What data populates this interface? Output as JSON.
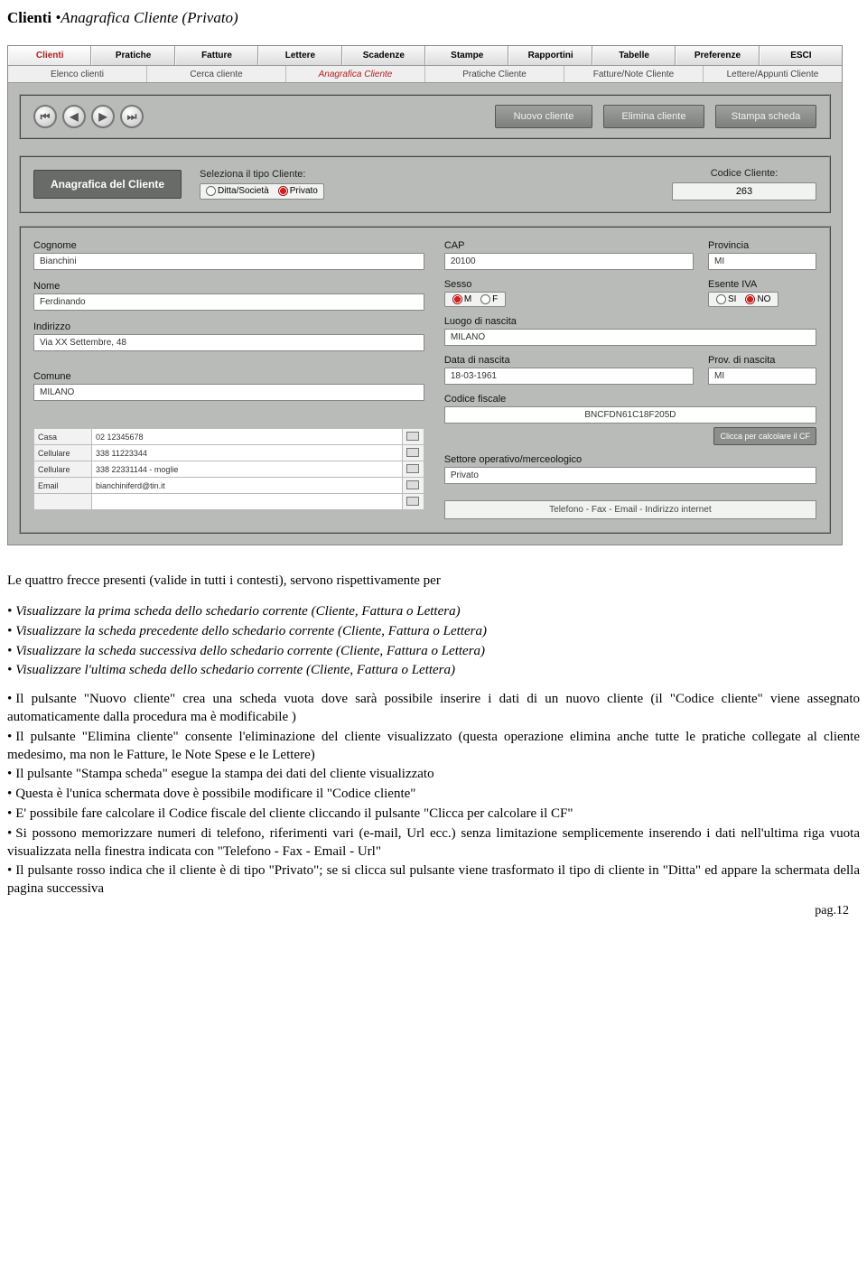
{
  "doc": {
    "title_bold": "Clienti ",
    "title_italic": "•Anagrafica Cliente (Privato)",
    "page_num": "pag.12"
  },
  "app": {
    "main_tabs": [
      "Clienti",
      "Pratiche",
      "Fatture",
      "Lettere",
      "Scadenze",
      "Stampe",
      "Rapportini",
      "Tabelle",
      "Preferenze",
      "ESCI"
    ],
    "main_tab_active_index": 0,
    "sub_tabs": [
      "Elenco clienti",
      "Cerca cliente",
      "Anagrafica Cliente",
      "Pratiche Cliente",
      "Fatture/Note Cliente",
      "Lettere/Appunti Cliente"
    ],
    "sub_tab_active_index": 2,
    "toolbar": {
      "nuovo": "Nuovo cliente",
      "elimina": "Elimina cliente",
      "stampa": "Stampa scheda"
    },
    "type_panel": {
      "title": "Anagrafica del Cliente",
      "select_label": "Seleziona il tipo Cliente:",
      "opt_ditta": "Ditta/Società",
      "opt_privato": "Privato",
      "selected": "Privato",
      "codice_label": "Codice Cliente:",
      "codice_value": "263"
    },
    "form": {
      "cognome_label": "Cognome",
      "cognome": "Bianchini",
      "nome_label": "Nome",
      "nome": "Ferdinando",
      "indirizzo_label": "Indirizzo",
      "indirizzo": "Via XX Settembre, 48",
      "comune_label": "Comune",
      "comune": "MILANO",
      "cap_label": "CAP",
      "cap": "20100",
      "provincia_label": "Provincia",
      "provincia": "MI",
      "sesso_label": "Sesso",
      "sesso_m": "M",
      "sesso_f": "F",
      "sesso_sel": "M",
      "esente_label": "Esente IVA",
      "esente_si": "SI",
      "esente_no": "NO",
      "esente_sel": "NO",
      "luogo_label": "Luogo di nascita",
      "luogo": "MILANO",
      "data_label": "Data di nascita",
      "data": "18-03-1961",
      "provn_label": "Prov. di nascita",
      "provn": "MI",
      "cf_label": "Codice fiscale",
      "cf": "BNCFDN61C18F205D",
      "cf_btn": "Clicca per calcolare il CF",
      "settore_label": "Settore operativo/merceologico",
      "settore": "Privato",
      "footer_strip": "Telefono - Fax - Email - Indirizzo internet"
    },
    "contacts": [
      {
        "type": "Casa",
        "value": "02 12345678"
      },
      {
        "type": "Cellulare",
        "value": "338 11223344"
      },
      {
        "type": "Cellulare",
        "value": "338 22331144 - moglie"
      },
      {
        "type": "Email",
        "value": "bianchiniferd@tin.it"
      },
      {
        "type": "",
        "value": ""
      }
    ]
  },
  "text": {
    "lead": "Le quattro frecce presenti (valide in tutti i contesti), servono rispettivamente per",
    "arrow1": "Visualizzare la prima scheda dello schedario corrente (Cliente, Fattura o Lettera)",
    "arrow2": "Visualizzare la scheda precedente dello schedario corrente (Cliente, Fattura o Lettera)",
    "arrow3": "Visualizzare la scheda successiva dello schedario corrente (Cliente, Fattura o Lettera)",
    "arrow4": "Visualizzare l'ultima scheda dello schedario corrente (Cliente, Fattura o Lettera)",
    "p1": "Il pulsante \"Nuovo cliente\" crea una scheda vuota dove sarà possibile inserire i dati di un nuovo cliente (il \"Codice cliente\" viene assegnato automaticamente dalla procedura ma è modificabile )",
    "p2": "Il pulsante \"Elimina cliente\" consente l'eliminazione del cliente visualizzato (questa operazione elimina anche tutte le pratiche collegate al cliente medesimo, ma non le Fatture, le Note Spese e le Lettere)",
    "p3": "Il pulsante \"Stampa scheda\" esegue la stampa dei dati del cliente visualizzato",
    "p4": "Questa è l'unica schermata dove è possibile modificare il \"Codice cliente\"",
    "p5": "E' possibile fare calcolare il Codice fiscale del cliente cliccando il pulsante \"Clicca per calcolare il CF\"",
    "p6": "Si possono memorizzare numeri di telefono, riferimenti vari (e-mail, Url ecc.) senza limitazione semplicemente inserendo i dati nell'ultima riga vuota visualizzata nella finestra indicata con \"Telefono - Fax - Email - Url\"",
    "p7": "Il pulsante rosso indica che il cliente è di tipo \"Privato\"; se si clicca sul pulsante viene trasformato il tipo di cliente in \"Ditta\" ed appare la schermata della pagina successiva"
  }
}
